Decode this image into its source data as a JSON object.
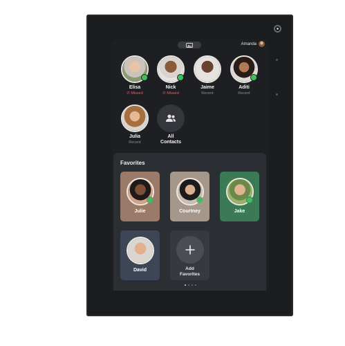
{
  "status_bar": {
    "user_name": "Amanda"
  },
  "recents": [
    {
      "name": "Elisa",
      "status": "Missed",
      "missed": true,
      "online": true
    },
    {
      "name": "Nick",
      "status": "Missed",
      "missed": true,
      "online": true
    },
    {
      "name": "Jaime",
      "status": "Recent",
      "missed": false,
      "online": false
    },
    {
      "name": "Aditi",
      "status": "Recent",
      "missed": false,
      "online": true
    },
    {
      "name": "Julia",
      "status": "Recent",
      "missed": false,
      "online": false
    }
  ],
  "all_contacts": {
    "label_line1": "All",
    "label_line2": "Contacts"
  },
  "favorites": {
    "title": "Favorites",
    "items": [
      {
        "name": "Julie",
        "online": true,
        "card_color": "#9a7a68"
      },
      {
        "name": "Courtney",
        "online": true,
        "card_color": "#a59789"
      },
      {
        "name": "Jake",
        "online": true,
        "card_color": "#3a7a55"
      },
      {
        "name": "David",
        "online": false,
        "card_color": "#3c4657"
      }
    ],
    "add": {
      "label_line1": "Add",
      "label_line2": "Favorites"
    }
  },
  "pager": {
    "pages": 4,
    "current": 1
  }
}
